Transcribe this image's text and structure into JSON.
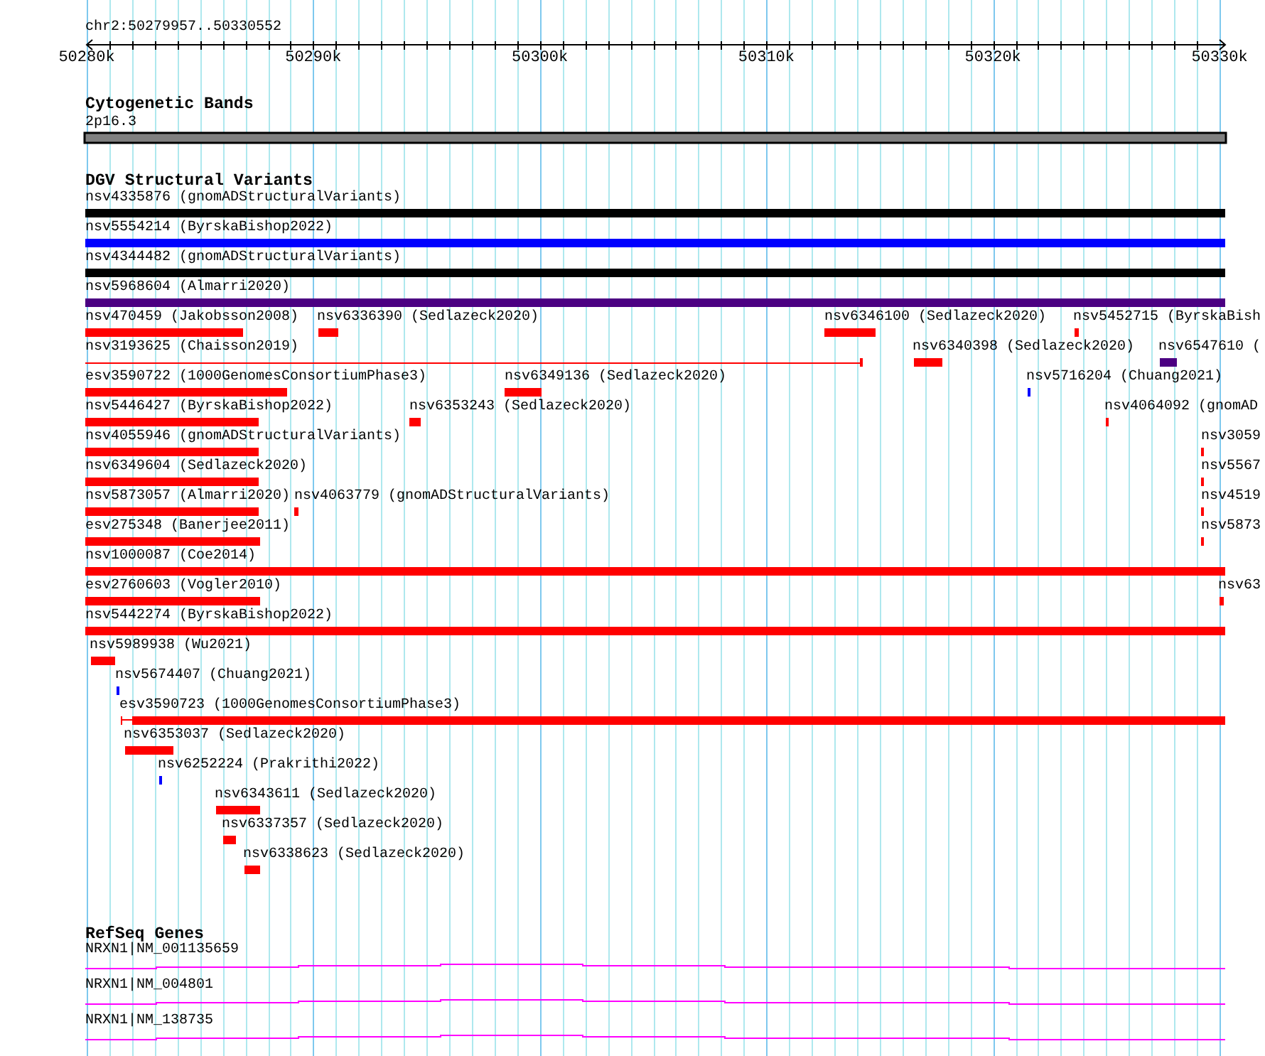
{
  "ruler": {
    "location": "chr2:50279957..50330552",
    "ticks": [
      "50280k",
      "50290k",
      "50300k",
      "50310k",
      "50320k",
      "50330k"
    ]
  },
  "tracks": [
    {
      "title": "Cytogenetic Bands",
      "kind": "bands",
      "features": [
        {
          "label": "2p16.3"
        }
      ]
    },
    {
      "title": "DGV Structural Variants",
      "kind": "variants",
      "features": [
        {
          "label": "nsv4335876 (gnomADStructuralVariants)",
          "kind": "bar",
          "color": "#000000"
        },
        {
          "label": "nsv5554214 (ByrskaBishop2022)",
          "kind": "bar",
          "color": "#0000ff"
        },
        {
          "label": "nsv4344482 (gnomADStructuralVariants)",
          "kind": "bar",
          "color": "#000000"
        },
        {
          "label": "nsv5968604 (Almarri2020)",
          "kind": "bar",
          "color": "#4b0082"
        },
        {
          "label": "nsv470459 (Jakobsson2008)",
          "kind": "bar",
          "color": "#ff0000"
        },
        {
          "label": "nsv6336390 (Sedlazeck2020)",
          "kind": "bar",
          "color": "#ff0000"
        },
        {
          "label": "nsv6346100 (Sedlazeck2020)",
          "kind": "bar",
          "color": "#ff0000"
        },
        {
          "label": "nsv5452715 (ByrskaBish",
          "kind": "bar",
          "color": "#ff0000"
        },
        {
          "label": "nsv3193625 (Chaisson2019)",
          "kind": "span",
          "color": "#ff0000"
        },
        {
          "label": "nsv6340398 (Sedlazeck2020)",
          "kind": "bar",
          "color": "#ff0000"
        },
        {
          "label": "nsv6547610 (",
          "kind": "bar",
          "color": "#4b0082"
        },
        {
          "label": "esv3590722 (1000GenomesConsortiumPhase3)",
          "kind": "bar",
          "color": "#ff0000"
        },
        {
          "label": "nsv6349136 (Sedlazeck2020)",
          "kind": "bar",
          "color": "#ff0000"
        },
        {
          "label": "nsv5716204 (Chuang2021)",
          "kind": "bar",
          "color": "#0000ff"
        },
        {
          "label": "nsv5446427 (ByrskaBishop2022)",
          "kind": "bar",
          "color": "#ff0000"
        },
        {
          "label": "nsv6353243 (Sedlazeck2020)",
          "kind": "bar",
          "color": "#ff0000"
        },
        {
          "label": "nsv4064092 (gnomAD",
          "kind": "bar",
          "color": "#ff0000"
        },
        {
          "label": "nsv4055946 (gnomADStructuralVariants)",
          "kind": "bar",
          "color": "#ff0000"
        },
        {
          "label": "nsv3059",
          "kind": "bar",
          "color": "#ff0000"
        },
        {
          "label": "nsv6349604 (Sedlazeck2020)",
          "kind": "bar",
          "color": "#ff0000"
        },
        {
          "label": "nsv5567",
          "kind": "bar",
          "color": "#ff0000"
        },
        {
          "label": "nsv5873057 (Almarri2020)",
          "kind": "bar",
          "color": "#ff0000"
        },
        {
          "label": "nsv4063779 (gnomADStructuralVariants)",
          "kind": "bar",
          "color": "#ff0000"
        },
        {
          "label": "nsv4519",
          "kind": "bar",
          "color": "#ff0000"
        },
        {
          "label": "esv275348 (Banerjee2011)",
          "kind": "bar",
          "color": "#ff0000"
        },
        {
          "label": "nsv5873",
          "kind": "bar",
          "color": "#ff0000"
        },
        {
          "label": "nsv1000087 (Coe2014)",
          "kind": "bar",
          "color": "#ff0000"
        },
        {
          "label": "esv2760603 (Vogler2010)",
          "kind": "bar",
          "color": "#ff0000"
        },
        {
          "label": "nsv63",
          "kind": "bar",
          "color": "#ff0000"
        },
        {
          "label": "nsv5442274 (ByrskaBishop2022)",
          "kind": "bar",
          "color": "#ff0000"
        },
        {
          "label": "nsv5989938 (Wu2021)",
          "kind": "bar",
          "color": "#ff0000"
        },
        {
          "label": "nsv5674407 (Chuang2021)",
          "kind": "bar",
          "color": "#0000ff"
        },
        {
          "label": "esv3590723 (1000GenomesConsortiumPhase3)",
          "kind": "split",
          "color": "#ff0000"
        },
        {
          "label": "nsv6353037 (Sedlazeck2020)",
          "kind": "bar",
          "color": "#ff0000"
        },
        {
          "label": "nsv6252224 (Prakrithi2022)",
          "kind": "bar",
          "color": "#0000ff"
        },
        {
          "label": "nsv6343611 (Sedlazeck2020)",
          "kind": "bar",
          "color": "#ff0000"
        },
        {
          "label": "nsv6337357 (Sedlazeck2020)",
          "kind": "bar",
          "color": "#ff0000"
        },
        {
          "label": "nsv6338623 (Sedlazeck2020)",
          "kind": "bar",
          "color": "#ff0000"
        }
      ]
    },
    {
      "title": "RefSeq Genes",
      "kind": "genes",
      "features": [
        {
          "label": "NRXN1|NM_001135659"
        },
        {
          "label": "NRXN1|NM_004801"
        },
        {
          "label": "NRXN1|NM_138735"
        }
      ]
    }
  ]
}
